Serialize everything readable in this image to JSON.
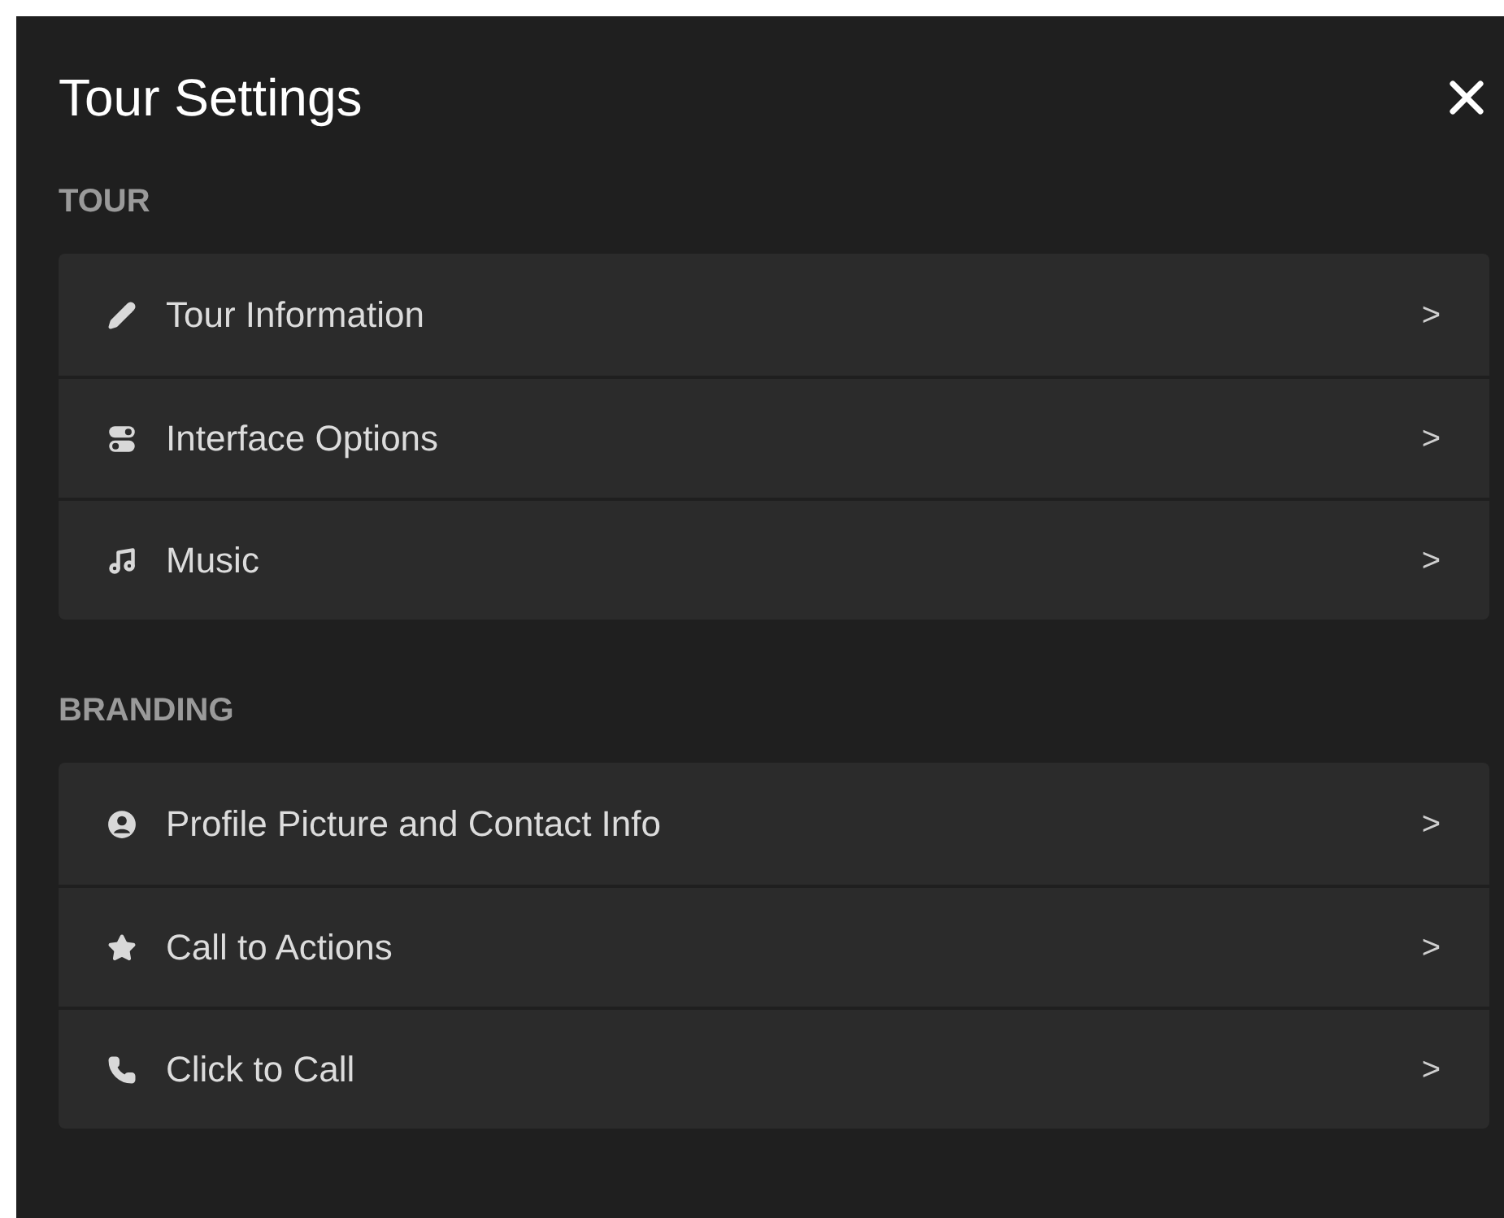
{
  "panel": {
    "title": "Tour Settings"
  },
  "sections": [
    {
      "heading": "TOUR",
      "items": [
        {
          "label": "Tour Information",
          "arrow": ">"
        },
        {
          "label": "Interface Options",
          "arrow": ">"
        },
        {
          "label": "Music",
          "arrow": ">"
        }
      ]
    },
    {
      "heading": "BRANDING",
      "items": [
        {
          "label": "Profile Picture and Contact Info",
          "arrow": ">"
        },
        {
          "label": "Call to Actions",
          "arrow": ">"
        },
        {
          "label": "Click to Call",
          "arrow": ">"
        }
      ]
    }
  ]
}
